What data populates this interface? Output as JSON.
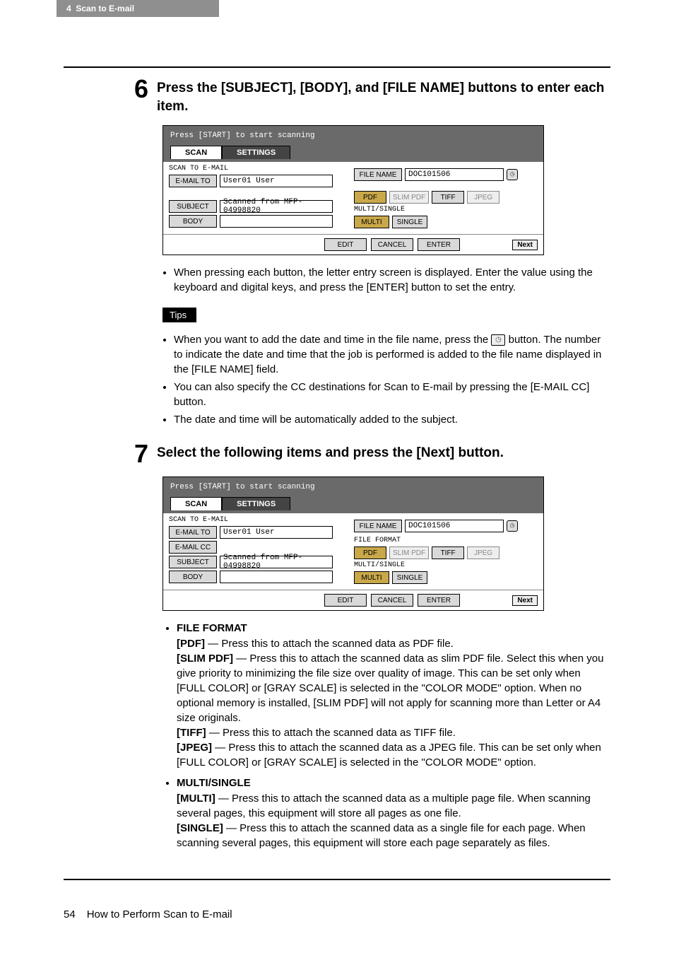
{
  "header": {
    "chapter_num": "4",
    "chapter_title": "Scan to E-mail"
  },
  "step6": {
    "num": "6",
    "title": "Press the [SUBJECT], [BODY], and [FILE NAME] buttons to enter each item.",
    "screenshot": {
      "top_msg": "Press [START] to start scanning",
      "tab_scan": "SCAN",
      "tab_settings": "SETTINGS",
      "section": "SCAN TO E-MAIL",
      "emailto_btn": "E-MAIL TO",
      "emailto_val": "User01 User",
      "subject_btn": "SUBJECT",
      "subject_val": "Scanned from MFP-04998820",
      "body_btn": "BODY",
      "filename_btn": "FILE NAME",
      "filename_val": "DOC101506",
      "format_section": "MULTI/SINGLE",
      "pdf": "PDF",
      "slimpdf": "SLIM PDF",
      "tiff": "TIFF",
      "jpeg": "JPEG",
      "multi": "MULTI",
      "single": "SINGLE",
      "edit": "EDIT",
      "cancel": "CANCEL",
      "enter": "ENTER",
      "next": "Next"
    },
    "bullet1": "When pressing each button, the letter entry screen is displayed.  Enter the value using the keyboard and digital keys, and press the [ENTER] button to set the entry.",
    "tips_label": "Tips",
    "tip1_a": "When you want to add the date and time in the file name, press the ",
    "tip1_b": " button.   The number to indicate the date and time that the job is performed is added to the file name displayed in the [FILE NAME] field.",
    "tip2": "You can also specify the CC destinations for Scan to E-mail by pressing the [E-MAIL CC] button.",
    "tip3": "The date and time will be automatically added to the subject."
  },
  "step7": {
    "num": "7",
    "title": "Select the following items and press the [Next] button.",
    "screenshot": {
      "top_msg": "Press [START] to start scanning",
      "tab_scan": "SCAN",
      "tab_settings": "SETTINGS",
      "section": "SCAN TO E-MAIL",
      "emailto_btn": "E-MAIL TO",
      "emailto_val": "User01 User",
      "emailcc_btn": "E-MAIL CC",
      "subject_btn": "SUBJECT",
      "subject_val": "Scanned from MFP-04998820",
      "body_btn": "BODY",
      "filename_btn": "FILE NAME",
      "filename_val": "DOC101506",
      "fileformat_label": "FILE FORMAT",
      "multisingle_label": "MULTI/SINGLE",
      "pdf": "PDF",
      "slimpdf": "SLIM PDF",
      "tiff": "TIFF",
      "jpeg": "JPEG",
      "multi": "MULTI",
      "single": "SINGLE",
      "edit": "EDIT",
      "cancel": "CANCEL",
      "enter": "ENTER",
      "next": "Next"
    },
    "fileformat_head": "FILE FORMAT",
    "pdf_desc": "[PDF] — Press this to attach the scanned data as PDF file.",
    "slimpdf_desc": "[SLIM PDF] — Press this to attach the scanned data as slim PDF file.  Select this when you give priority to minimizing the file size over quality of image.  This can be set only when [FULL COLOR] or [GRAY SCALE] is selected in the \"COLOR MODE\" option.  When no optional memory is installed, [SLIM PDF] will not apply for scanning more than Letter or A4 size originals.",
    "tiff_desc": "[TIFF] — Press this to attach the scanned data as TIFF file.",
    "jpeg_desc": "[JPEG] — Press this to attach the scanned data as a JPEG file.  This can be set only when [FULL COLOR] or [GRAY SCALE] is selected in the \"COLOR MODE\" option.",
    "multisingle_head": "MULTI/SINGLE",
    "multi_desc": "[MULTI] — Press this to attach the scanned data as a multiple page file.  When scanning several pages, this equipment will store all pages as one file.",
    "single_desc": "[SINGLE] — Press this to attach the scanned data as a single file for each page.  When scanning several pages, this equipment will store each page separately as files."
  },
  "footer": {
    "page_num": "54",
    "page_title": "How to Perform Scan to E-mail"
  }
}
